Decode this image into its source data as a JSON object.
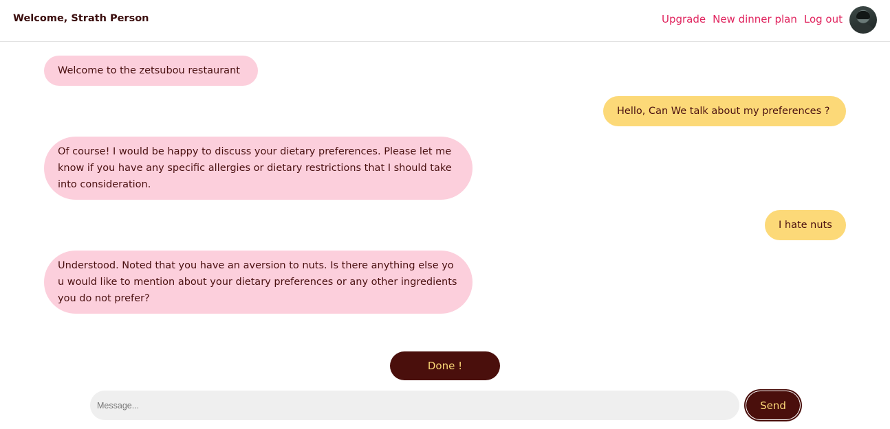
{
  "header": {
    "welcome": "Welcome, Strath Person",
    "nav": {
      "upgrade": "Upgrade",
      "new_dinner_plan": "New dinner plan",
      "log_out": "Log out"
    },
    "avatar_icon": "user-avatar"
  },
  "chat": {
    "messages": [
      {
        "sender": "bot",
        "text": "Welcome to the zetsubou restaurant"
      },
      {
        "sender": "user",
        "text": "Hello, Can We talk about my preferences ?"
      },
      {
        "sender": "bot",
        "text": "Of course! I would be happy to discuss your dietary preferences. Please let me know if you have any specific allergies or dietary restrictions that I should take into consideration."
      },
      {
        "sender": "user",
        "text": "I hate nuts"
      },
      {
        "sender": "bot",
        "text": "Understood. Noted that you have an aversion to nuts. Is there anything else you would like to mention about your dietary preferences or any other ingredients you do not prefer?"
      }
    ]
  },
  "actions": {
    "done_label": "Done !",
    "send_label": "Send"
  },
  "composer": {
    "placeholder": "Message...",
    "value": ""
  },
  "colors": {
    "bot_bubble": "#fccfdc",
    "user_bubble": "#fcd978",
    "button_bg": "#4a0f0c",
    "button_text": "#fcd978",
    "nav_link": "#e0245e",
    "text": "#4a1010"
  }
}
